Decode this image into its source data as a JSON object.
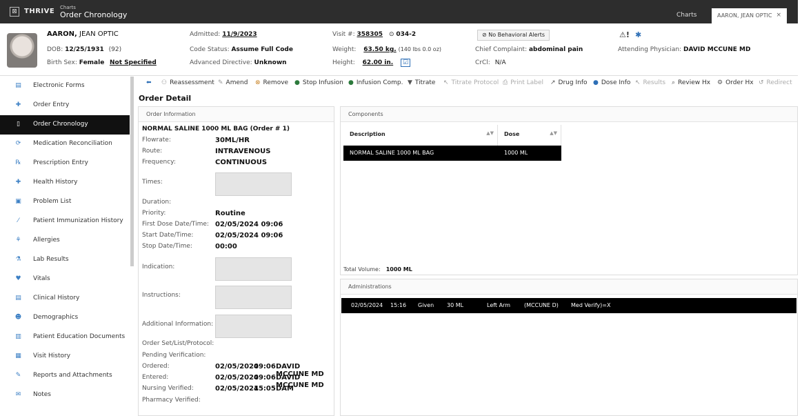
{
  "app": {
    "name": "THRIVE",
    "crumb_top": "Charts",
    "crumb_main": "Order Chronology",
    "tab_charts": "Charts",
    "tab_patient": "AARON, JEAN OPTIC",
    "tab_close": "×"
  },
  "patient": {
    "name_last": "AARON,",
    "name_first": " JEAN OPTIC",
    "dob_label": "DOB:",
    "dob": "12/25/1931",
    "age": "(92)",
    "birth_sex_label": "Birth Sex:",
    "birth_sex": "Female",
    "gender": "Not Specified",
    "admitted_label": "Admitted:",
    "admitted": "11/9/2023",
    "code_status_label": "Code Status:",
    "code_status": "Assume Full Code",
    "adv_directive_label": "Advanced Directive:",
    "adv_directive": "Unknown",
    "visit_label": "Visit #:",
    "visit": "358305",
    "room": "034-2",
    "weight_label": "Weight:",
    "weight": "63.50 kg.",
    "weight_lb": "(140 lbs 0.0 oz)",
    "height_label": "Height:",
    "height": "62.00 in.",
    "behavioral_alerts": "No Behavioral Alerts",
    "chief_complaint_label": "Chief Complaint:",
    "chief_complaint": "abdominal pain",
    "crcl_label": "CrCl:",
    "crcl": "N/A",
    "attending_label": "Attending Physician:",
    "attending": "DAVID MCCUNE MD"
  },
  "sidebar": {
    "items": [
      {
        "label": "Electronic Forms",
        "icon": "▤"
      },
      {
        "label": "Order Entry",
        "icon": "✚"
      },
      {
        "label": "Order Chronology",
        "icon": "▯"
      },
      {
        "label": "Medication Reconciliation",
        "icon": "⟳"
      },
      {
        "label": "Prescription Entry",
        "icon": "℞"
      },
      {
        "label": "Health History",
        "icon": "✚"
      },
      {
        "label": "Problem List",
        "icon": "▣"
      },
      {
        "label": "Patient Immunization History",
        "icon": "⁄"
      },
      {
        "label": "Allergies",
        "icon": "⚘"
      },
      {
        "label": "Lab Results",
        "icon": "⚗"
      },
      {
        "label": "Vitals",
        "icon": "♥"
      },
      {
        "label": "Clinical History",
        "icon": "▤"
      },
      {
        "label": "Demographics",
        "icon": "☻"
      },
      {
        "label": "Patient Education Documents",
        "icon": "▥"
      },
      {
        "label": "Visit History",
        "icon": "▦"
      },
      {
        "label": "Reports and Attachments",
        "icon": "✎"
      },
      {
        "label": "Notes",
        "icon": "✉"
      }
    ]
  },
  "toolbar": {
    "back": "⬅",
    "reassessment": "Reassessment",
    "amend": "Amend",
    "remove": "Remove",
    "stop_infusion": "Stop Infusion",
    "infusion_comp": "Infusion Comp.",
    "titrate": "Titrate",
    "titrate_protocol": "Titrate Protocol",
    "print_label": "Print Label",
    "drug_info": "Drug Info",
    "dose_info": "Dose Info",
    "results": "Results",
    "review_hx": "Review Hx",
    "order_hx": "Order Hx",
    "redirect": "Redirect"
  },
  "detail": {
    "title": "Order Detail",
    "order_info_header": "Order Information",
    "order_name": "NORMAL SALINE 1000 ML BAG (Order # 1)",
    "flowrate_label": "Flowrate:",
    "flowrate": "30ML/HR",
    "route_label": "Route:",
    "route": "INTRAVENOUS",
    "frequency_label": "Frequency:",
    "frequency": "CONTINUOUS",
    "times_label": "Times:",
    "duration_label": "Duration:",
    "priority_label": "Priority:",
    "priority": "Routine",
    "first_dose_label": "First Dose Date/Time:",
    "first_dose": "02/05/2024 09:06",
    "start_label": "Start Date/Time:",
    "start": "02/05/2024 09:06",
    "stop_label": "Stop Date/Time:",
    "stop": "00:00",
    "indication_label": "Indication:",
    "instructions_label": "Instructions:",
    "additional_label": "Additional Information:",
    "order_set_label": "Order Set/List/Protocol:",
    "pending_label": "Pending Verification:",
    "ordered_label": "Ordered:",
    "ordered_date": "02/05/2024",
    "ordered_time": "09:06",
    "ordered_by": "DAVID MCCUNE MD",
    "entered_label": "Entered:",
    "entered_date": "02/05/2024",
    "entered_time": "09:06",
    "entered_by": "DAVID MCCUNE MD",
    "nursing_label": "Nursing Verified:",
    "nursing_date": "02/05/2024",
    "nursing_time": "15:05",
    "nursing_by": "DAM",
    "pharmacy_label": "Pharmacy Verified:"
  },
  "components": {
    "header": "Components",
    "columns": [
      "Description",
      "Dose"
    ],
    "rows": [
      {
        "description": "NORMAL SALINE 1000 ML BAG",
        "dose": "1000 ML"
      }
    ],
    "total_label": "Total Volume:",
    "total": "1000 ML"
  },
  "administrations": {
    "header": "Administrations",
    "rows": [
      {
        "date": "02/05/2024",
        "time": "15:16",
        "status": "Given",
        "amount": "30 ML",
        "site": "Left Arm",
        "user": "(MCCUNE D)",
        "verify": "Med Verify)=X"
      }
    ]
  },
  "colors": {
    "topbar": "#2d2d2d",
    "active_nav": "#111111",
    "selected_row": "#000000",
    "accent_blue": "#2e6fb6"
  }
}
